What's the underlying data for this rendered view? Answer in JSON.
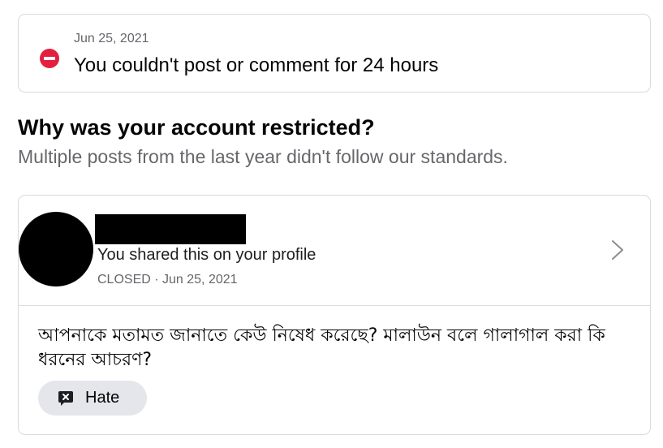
{
  "notice": {
    "date": "Jun 25, 2021",
    "title": "You couldn't post or comment for 24 hours",
    "icon": "minus-circle-icon",
    "icon_color": "#e41e3f"
  },
  "reason": {
    "heading": "Why was your account restricted?",
    "subheading": "Multiple posts from the last year didn't follow our standards."
  },
  "post": {
    "shared_text": "You shared this on your profile",
    "meta": "CLOSED · Jun 25, 2021",
    "text": "আপনাকে মতামত জানাতে কেউ নিষেধ করেছে? মালাউন বলে গালাগাল করা কি ধরনের আচরণ?",
    "tag": {
      "label": "Hate",
      "icon": "hate-speech-icon"
    },
    "chevron_icon": "chevron-right-icon"
  },
  "colors": {
    "text_primary": "#050505",
    "text_secondary": "#65676b",
    "border": "#d9dadd",
    "chip_bg": "#e4e6eb"
  }
}
